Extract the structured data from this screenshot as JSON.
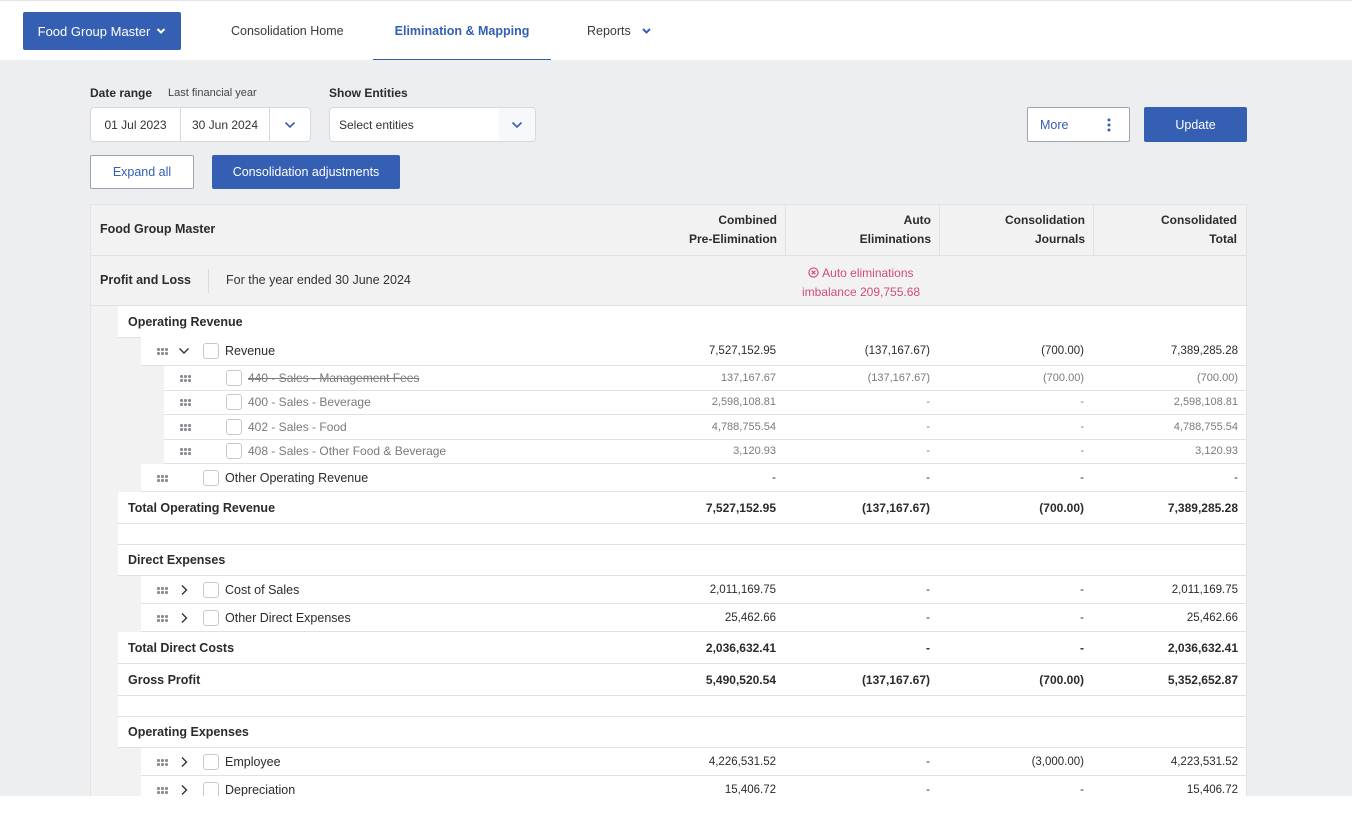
{
  "topnav": {
    "org_button": "Food Group Master",
    "tabs": [
      {
        "label": "Consolidation Home",
        "active": false
      },
      {
        "label": "Elimination & Mapping",
        "active": true
      },
      {
        "label": "Reports",
        "active": false,
        "has_dropdown": true
      }
    ]
  },
  "filters": {
    "date_range_label": "Date range",
    "date_range_preset": "Last financial year",
    "start_date": "01 Jul 2023",
    "end_date": "30 Jun 2024",
    "show_entities_label": "Show Entities",
    "entities_placeholder": "Select entities"
  },
  "actions": {
    "more": "More",
    "update": "Update",
    "expand_all": "Expand all",
    "consolidation_adjustments": "Consolidation adjustments"
  },
  "colors": {
    "brand": "#355fb3",
    "warning": "#d14b7c",
    "background": "#edeef0"
  },
  "report": {
    "title": "Food Group Master",
    "columns": [
      {
        "line1": "Combined",
        "line2": "Pre-Elimination"
      },
      {
        "line1": "Auto",
        "line2": "Eliminations"
      },
      {
        "line1": "Consolidation",
        "line2": "Journals"
      },
      {
        "line1": "Consolidated",
        "line2": "Total"
      }
    ],
    "statement": "Profit and Loss",
    "period": "For the year ended 30 June 2024",
    "warning_line1": "Auto eliminations",
    "warning_line2": "imbalance 209,755.68",
    "rows": [
      {
        "type": "section",
        "label": "Operating Revenue"
      },
      {
        "type": "group",
        "label": "Revenue",
        "expanded": true,
        "values": [
          "7,527,152.95",
          "(137,167.67)",
          "(700.00)",
          "7,389,285.28"
        ]
      },
      {
        "type": "account",
        "label": "440 - Sales - Management Fees",
        "struck": true,
        "values": [
          "137,167.67",
          "(137,167.67)",
          "(700.00)",
          "(700.00)"
        ]
      },
      {
        "type": "account",
        "label": "400 - Sales - Beverage",
        "values": [
          "2,598,108.81",
          "-",
          "-",
          "2,598,108.81"
        ]
      },
      {
        "type": "account",
        "label": "402 - Sales - Food",
        "values": [
          "4,788,755.54",
          "-",
          "-",
          "4,788,755.54"
        ]
      },
      {
        "type": "account",
        "label": "408 - Sales - Other Food & Beverage",
        "values": [
          "3,120.93",
          "-",
          "-",
          "3,120.93"
        ]
      },
      {
        "type": "group",
        "label": "Other Operating Revenue",
        "expandable": false,
        "values": [
          "-",
          "-",
          "-",
          "-"
        ]
      },
      {
        "type": "total",
        "label": "Total Operating Revenue",
        "values": [
          "7,527,152.95",
          "(137,167.67)",
          "(700.00)",
          "7,389,285.28"
        ]
      },
      {
        "type": "spacer"
      },
      {
        "type": "section",
        "label": "Direct Expenses"
      },
      {
        "type": "group",
        "label": "Cost of Sales",
        "expanded": false,
        "values": [
          "2,011,169.75",
          "-",
          "-",
          "2,011,169.75"
        ]
      },
      {
        "type": "group",
        "label": "Other Direct Expenses",
        "expanded": false,
        "values": [
          "25,462.66",
          "-",
          "-",
          "25,462.66"
        ]
      },
      {
        "type": "total",
        "label": "Total Direct Costs",
        "values": [
          "2,036,632.41",
          "-",
          "-",
          "2,036,632.41"
        ]
      },
      {
        "type": "total",
        "label": "Gross Profit",
        "values": [
          "5,490,520.54",
          "(137,167.67)",
          "(700.00)",
          "5,352,652.87"
        ]
      },
      {
        "type": "spacer"
      },
      {
        "type": "section",
        "label": "Operating Expenses"
      },
      {
        "type": "group",
        "label": "Employee",
        "expanded": false,
        "values": [
          "4,226,531.52",
          "-",
          "(3,000.00)",
          "4,223,531.52"
        ]
      },
      {
        "type": "group",
        "label": "Depreciation",
        "expanded": false,
        "values": [
          "15,406.72",
          "-",
          "-",
          "15,406.72"
        ]
      }
    ]
  }
}
